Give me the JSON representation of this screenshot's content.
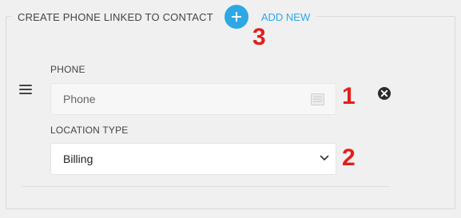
{
  "fieldset": {
    "title": "CREATE PHONE LINKED TO CONTACT",
    "add_label": "ADD NEW",
    "add_icon": "plus-icon"
  },
  "row": {
    "drag_icon": "hamburger-icon",
    "remove_icon": "close-circle-icon",
    "phone": {
      "label": "PHONE",
      "placeholder": "Phone",
      "value": "",
      "icon": "card-icon"
    },
    "location_type": {
      "label": "LOCATION TYPE",
      "selected": "Billing",
      "icon": "chevron-down-icon"
    }
  },
  "annotations": [
    "1",
    "2",
    "3"
  ],
  "colors": {
    "accent": "#2ea8e5",
    "annotation": "#e0201b",
    "background": "#f0f0f0"
  }
}
